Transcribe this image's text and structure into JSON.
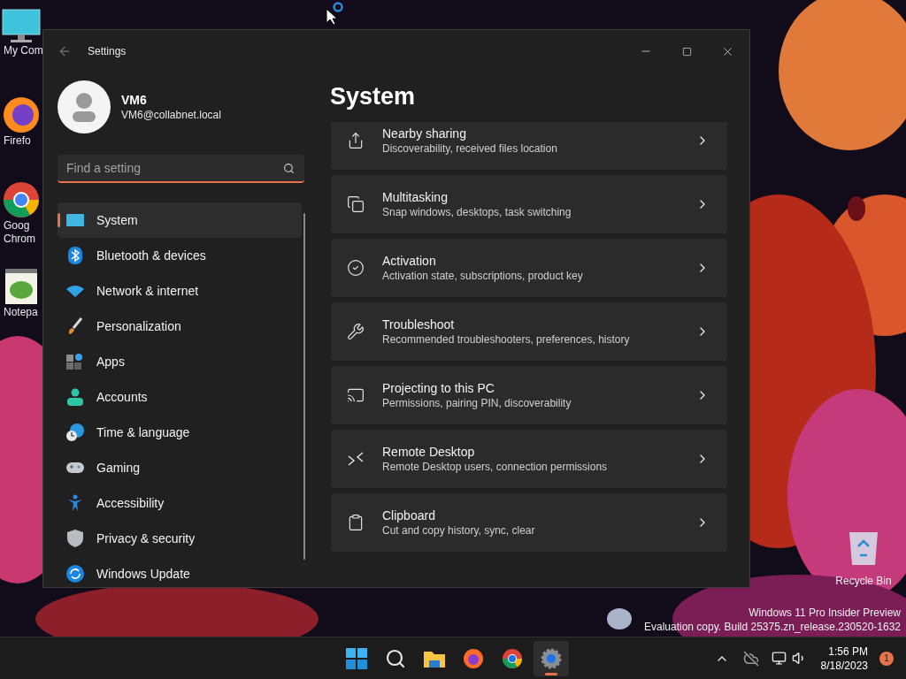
{
  "desktop": {
    "icons": [
      {
        "kind": "computer",
        "lines": [
          "My Com"
        ]
      },
      {
        "kind": "firefox",
        "lines": [
          "Firefo"
        ]
      },
      {
        "kind": "chrome",
        "lines": [
          "Goog",
          "Chrom"
        ]
      },
      {
        "kind": "notepad",
        "lines": [
          "Notepa"
        ]
      }
    ],
    "recycle_bin": {
      "label": "Recycle Bin"
    },
    "watermark": [
      "Windows 11 Pro Insider Preview",
      "Evaluation copy. Build 25375.zn_release.230520-1632"
    ]
  },
  "window": {
    "title": "Settings",
    "user": {
      "name": "VM6",
      "email": "VM6@collabnet.local"
    },
    "search": {
      "placeholder": "Find a setting"
    },
    "nav": [
      {
        "label": "System",
        "selected": true
      },
      {
        "label": "Bluetooth & devices",
        "selected": false
      },
      {
        "label": "Network & internet",
        "selected": false
      },
      {
        "label": "Personalization",
        "selected": false
      },
      {
        "label": "Apps",
        "selected": false
      },
      {
        "label": "Accounts",
        "selected": false
      },
      {
        "label": "Time & language",
        "selected": false
      },
      {
        "label": "Gaming",
        "selected": false
      },
      {
        "label": "Accessibility",
        "selected": false
      },
      {
        "label": "Privacy & security",
        "selected": false
      },
      {
        "label": "Windows Update",
        "selected": false
      }
    ],
    "heading": "System",
    "cards": [
      {
        "title": "Nearby sharing",
        "subtitle": "Discoverability, received files location"
      },
      {
        "title": "Multitasking",
        "subtitle": "Snap windows, desktops, task switching"
      },
      {
        "title": "Activation",
        "subtitle": "Activation state, subscriptions, product key"
      },
      {
        "title": "Troubleshoot",
        "subtitle": "Recommended troubleshooters, preferences, history"
      },
      {
        "title": "Projecting to this PC",
        "subtitle": "Permissions, pairing PIN, discoverability"
      },
      {
        "title": "Remote Desktop",
        "subtitle": "Remote Desktop users, connection permissions"
      },
      {
        "title": "Clipboard",
        "subtitle": "Cut and copy history, sync, clear"
      }
    ]
  },
  "taskbar": {
    "apps": [
      {
        "kind": "start",
        "selected": false
      },
      {
        "kind": "search",
        "selected": false
      },
      {
        "kind": "folder",
        "selected": false
      },
      {
        "kind": "firefox",
        "selected": false
      },
      {
        "kind": "chrome",
        "selected": false
      },
      {
        "kind": "settings",
        "selected": true
      }
    ],
    "time": "1:56 PM",
    "date": "8/18/2023",
    "notification_count": "1"
  }
}
